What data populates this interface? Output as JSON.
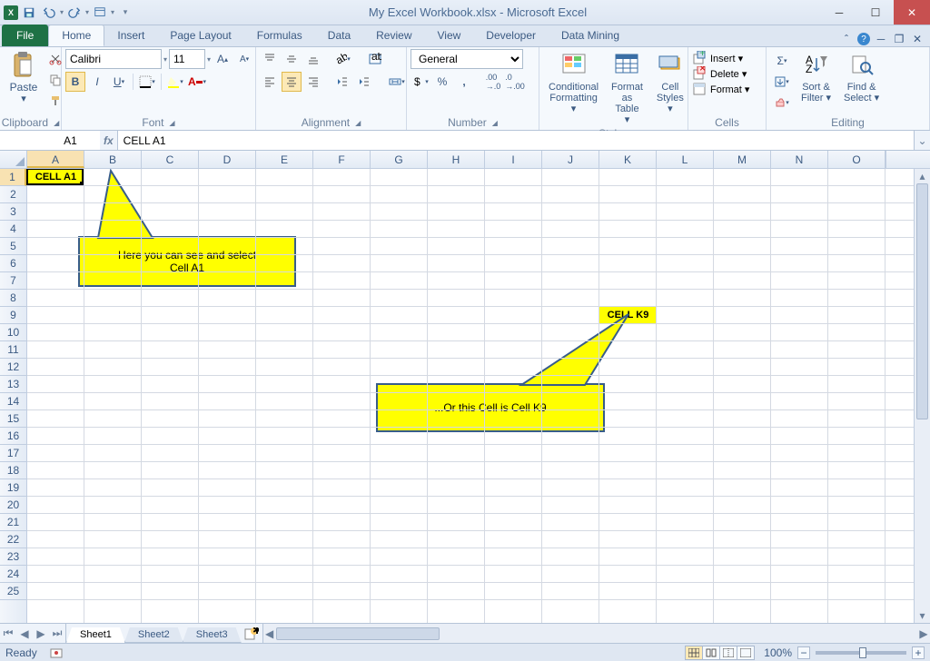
{
  "title": "My Excel Workbook.xlsx - Microsoft Excel",
  "qat": {
    "save": "Save",
    "undo": "Undo",
    "redo": "Redo"
  },
  "tabs": {
    "file": "File",
    "items": [
      "Home",
      "Insert",
      "Page Layout",
      "Formulas",
      "Data",
      "Review",
      "View",
      "Developer",
      "Data Mining"
    ],
    "active": "Home"
  },
  "ribbon": {
    "clipboard": {
      "label": "Clipboard",
      "paste": "Paste"
    },
    "font": {
      "label": "Font",
      "name": "Calibri",
      "size": "11"
    },
    "alignment": {
      "label": "Alignment"
    },
    "number": {
      "label": "Number",
      "format": "General"
    },
    "styles": {
      "label": "Styles",
      "cond": "Conditional\nFormatting ▾",
      "table": "Format\nas Table ▾",
      "cell": "Cell\nStyles ▾"
    },
    "cells": {
      "label": "Cells",
      "insert": "Insert ▾",
      "delete": "Delete ▾",
      "format": "Format ▾"
    },
    "editing": {
      "label": "Editing",
      "sort": "Sort &\nFilter ▾",
      "find": "Find &\nSelect ▾"
    }
  },
  "namebox": "A1",
  "formula": "CELL A1",
  "columns": [
    "A",
    "B",
    "C",
    "D",
    "E",
    "F",
    "G",
    "H",
    "I",
    "J",
    "K",
    "L",
    "M",
    "N",
    "O"
  ],
  "rows_visible": 25,
  "cells": {
    "A1": "CELL A1",
    "K9": "CELL K9"
  },
  "callout1_line1": "Here you can see and select",
  "callout1_line2": "Cell A1",
  "callout2": "...Or this Cell is Cell K9",
  "sheets": [
    "Sheet1",
    "Sheet2",
    "Sheet3"
  ],
  "active_sheet": "Sheet1",
  "status_ready": "Ready",
  "zoom": "100%"
}
